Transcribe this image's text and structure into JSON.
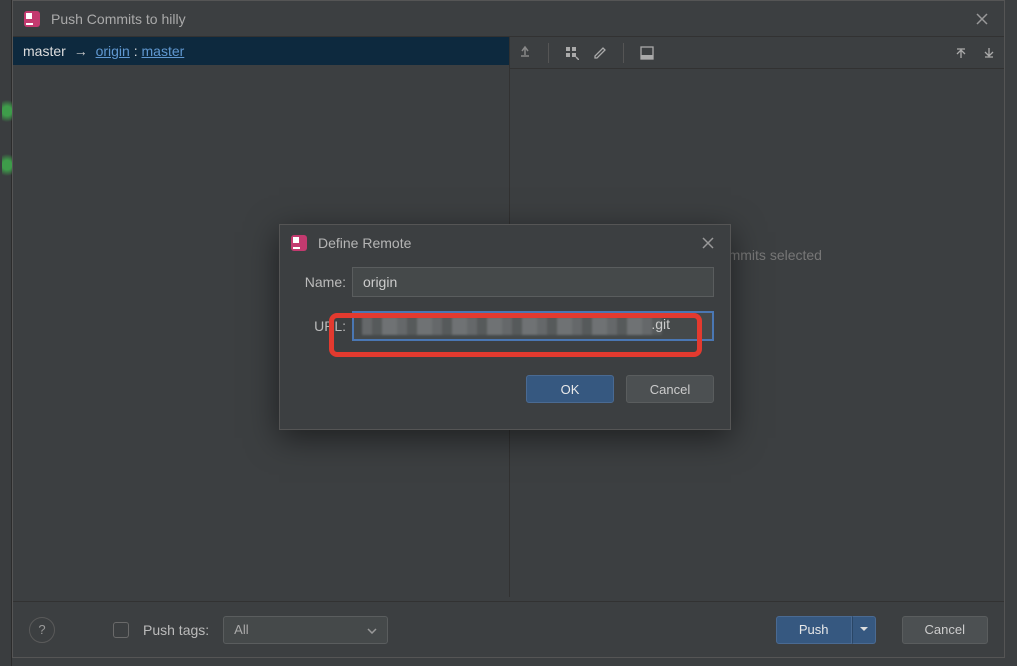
{
  "window": {
    "title": "Push Commits to hilly"
  },
  "branch": {
    "local": "master",
    "remote": "origin",
    "remote_branch": "master"
  },
  "right_panel": {
    "empty_text": "No commits selected"
  },
  "footer": {
    "push_tags_label": "Push tags:",
    "tags_select_value": "All",
    "push_label": "Push",
    "cancel_label": "Cancel"
  },
  "modal": {
    "title": "Define Remote",
    "name_label": "Name:",
    "name_value": "origin",
    "url_label": "URL:",
    "url_suffix": ".git",
    "ok_label": "OK",
    "cancel_label": "Cancel"
  }
}
